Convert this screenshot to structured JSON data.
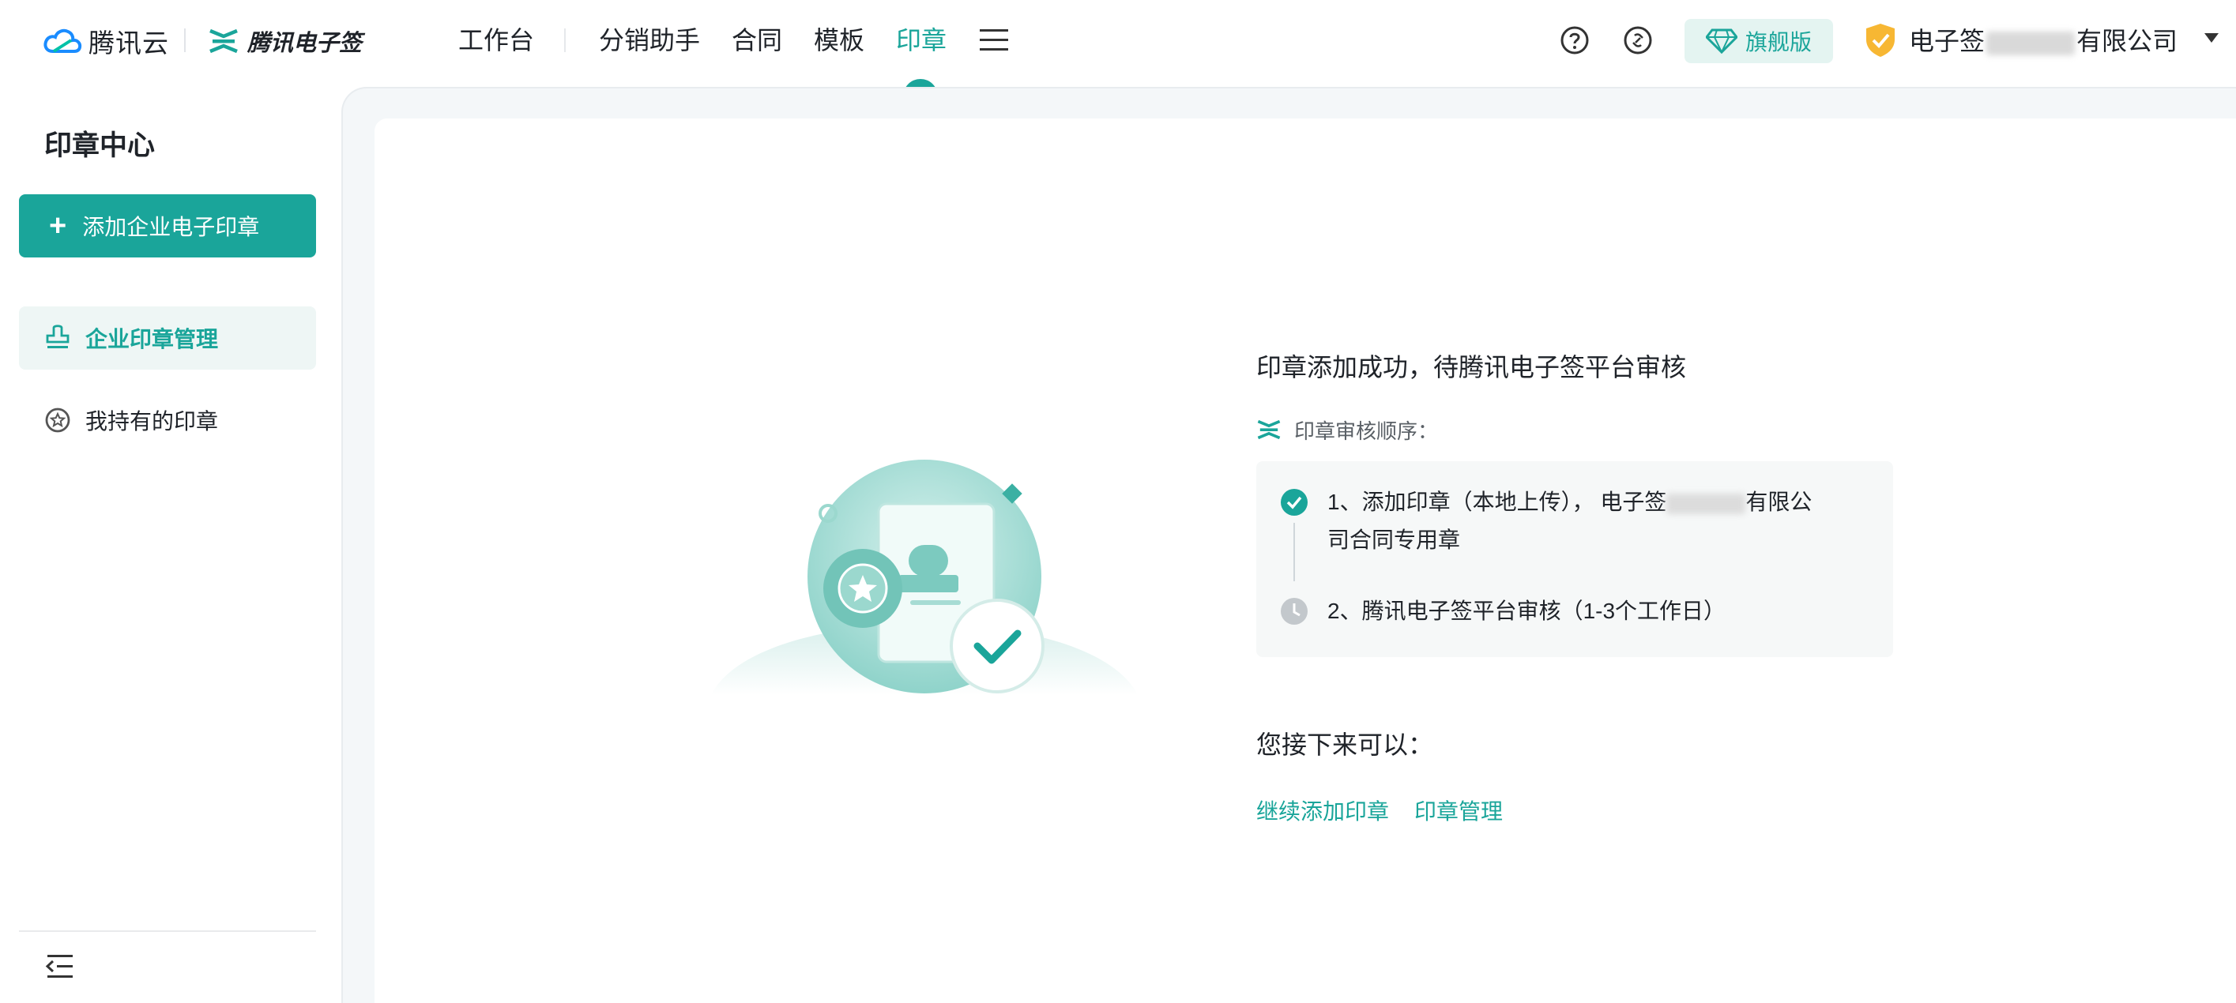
{
  "header": {
    "cloud_brand": "腾讯云",
    "product_brand": "腾讯电子签",
    "nav": [
      {
        "label": "工作台",
        "active": false
      },
      {
        "label": "分销助手",
        "active": false
      },
      {
        "label": "合同",
        "active": false
      },
      {
        "label": "模板",
        "active": false
      },
      {
        "label": "印章",
        "active": true
      }
    ],
    "edition": "旗舰版",
    "company_prefix": "电子签",
    "company_suffix": "有限公司",
    "icons": [
      "help-icon",
      "link-icon",
      "diamond-icon",
      "shield-icon",
      "menu-icon"
    ]
  },
  "sidebar": {
    "title": "印章中心",
    "add_button": "添加企业电子印章",
    "items": [
      {
        "label": "企业印章管理",
        "icon": "stamp-icon",
        "active": true
      },
      {
        "label": "我持有的印章",
        "icon": "star-badge-icon",
        "active": false
      }
    ]
  },
  "result": {
    "title": "印章添加成功，待腾讯电子签平台审核",
    "order_label": "印章审核顺序：",
    "steps": [
      {
        "prefix": "1、添加印章（本地上传）， 电子签",
        "suffix": "有限公司合同专用章",
        "status": "done"
      },
      {
        "text": "2、腾讯电子签平台审核（1-3个工作日）",
        "status": "pending"
      }
    ],
    "next_title": "您接下来可以：",
    "links": [
      "继续添加印章",
      "印章管理"
    ]
  },
  "colors": {
    "accent": "#1aa59a",
    "accent_light": "#e4f4f1",
    "background": "#f4f7f9",
    "text": "#1f2329",
    "muted": "#5a6066"
  }
}
